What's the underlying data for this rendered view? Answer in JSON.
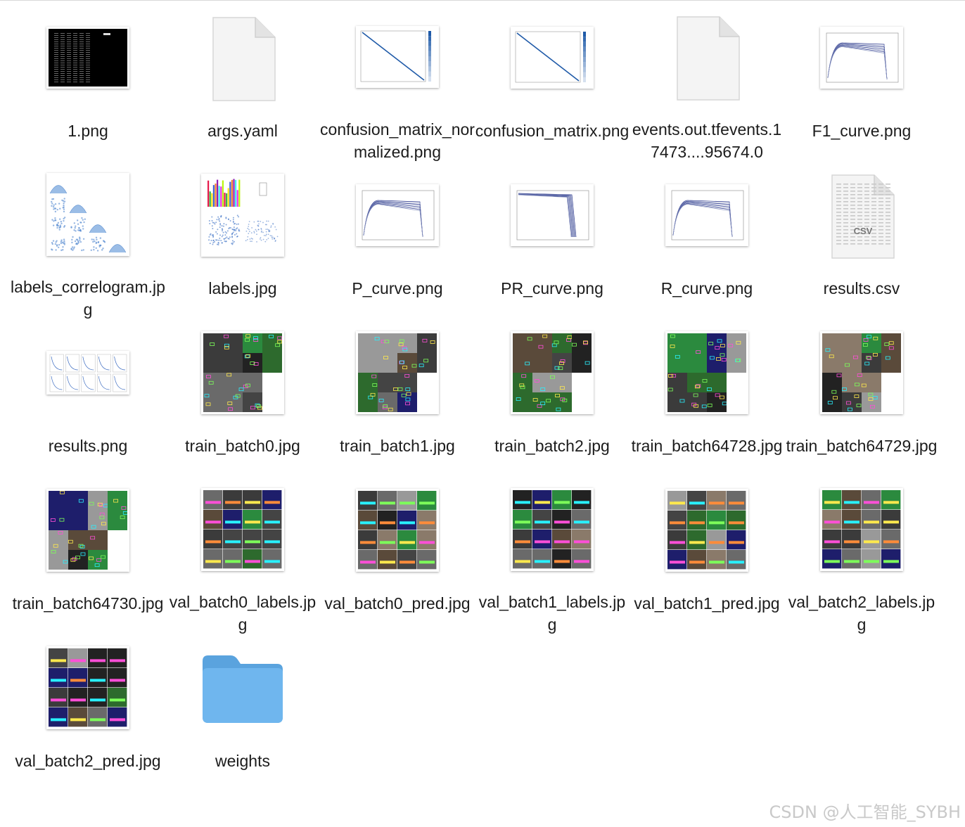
{
  "files": [
    {
      "name": "1.png",
      "kind": "terminal"
    },
    {
      "name": "args.yaml",
      "kind": "doc"
    },
    {
      "name": "confusion_matrix_normalized.png",
      "kind": "matrix"
    },
    {
      "name": "confusion_matrix.png",
      "kind": "matrix"
    },
    {
      "name": "events.out.tfevents.17473....95674.0",
      "kind": "doc"
    },
    {
      "name": "F1_curve.png",
      "kind": "curve"
    },
    {
      "name": "labels_correlogram.jpg",
      "kind": "correlogram"
    },
    {
      "name": "labels.jpg",
      "kind": "labels"
    },
    {
      "name": "P_curve.png",
      "kind": "curve"
    },
    {
      "name": "PR_curve.png",
      "kind": "pr"
    },
    {
      "name": "R_curve.png",
      "kind": "curve"
    },
    {
      "name": "results.csv",
      "kind": "csv",
      "badge": "CSV"
    },
    {
      "name": "results.png",
      "kind": "results"
    },
    {
      "name": "train_batch0.jpg",
      "kind": "mosaic"
    },
    {
      "name": "train_batch1.jpg",
      "kind": "mosaic"
    },
    {
      "name": "train_batch2.jpg",
      "kind": "mosaic"
    },
    {
      "name": "train_batch64728.jpg",
      "kind": "mosaic"
    },
    {
      "name": "train_batch64729.jpg",
      "kind": "mosaic"
    },
    {
      "name": "train_batch64730.jpg",
      "kind": "mosaic"
    },
    {
      "name": "val_batch0_labels.jpg",
      "kind": "grid"
    },
    {
      "name": "val_batch0_pred.jpg",
      "kind": "grid"
    },
    {
      "name": "val_batch1_labels.jpg",
      "kind": "grid"
    },
    {
      "name": "val_batch1_pred.jpg",
      "kind": "grid"
    },
    {
      "name": "val_batch2_labels.jpg",
      "kind": "grid"
    },
    {
      "name": "val_batch2_pred.jpg",
      "kind": "grid"
    },
    {
      "name": "weights",
      "kind": "folder"
    }
  ],
  "watermark": "CSDN @人工智能_SYBH",
  "colors": {
    "folder": "#6fb6ee",
    "folder_tab": "#5aa3de"
  }
}
